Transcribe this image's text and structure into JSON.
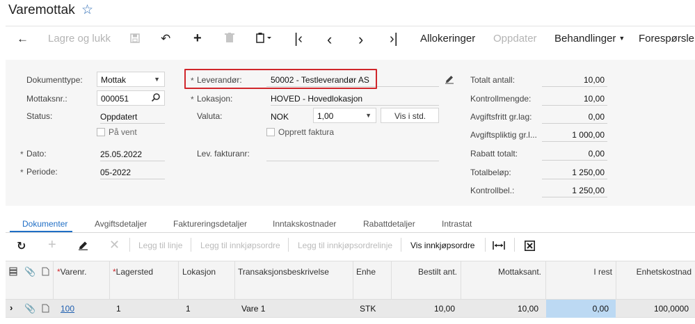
{
  "page": {
    "title": "Varemottak"
  },
  "toolbar": {
    "save_close": "Lagre og lukk",
    "allocations": "Allokeringer",
    "update": "Oppdater",
    "actions": "Behandlinger",
    "inquiries": "Forespørsler"
  },
  "form": {
    "doc_type": {
      "label": "Dokumenttype:",
      "value": "Mottak"
    },
    "receipt_no": {
      "label": "Mottaksnr.:",
      "value": "000051"
    },
    "status": {
      "label": "Status:",
      "value": "Oppdatert"
    },
    "on_hold": {
      "label": "På vent"
    },
    "date": {
      "label": "Dato:",
      "value": "25.05.2022"
    },
    "period": {
      "label": "Periode:",
      "value": "05-2022"
    },
    "supplier": {
      "label": "Leverandør:",
      "value": "50002 - Testleverandør AS"
    },
    "location": {
      "label": "Lokasjon:",
      "value": "HOVED - Hovedlokasjon"
    },
    "currency": {
      "label": "Valuta:",
      "code": "NOK",
      "rate": "1,00",
      "view_label": "Vis i std."
    },
    "create_invoice": {
      "label": "Opprett faktura"
    },
    "supplier_invoice": {
      "label": "Lev. fakturanr:",
      "value": ""
    }
  },
  "totals": [
    {
      "label": "Totalt antall:",
      "value": "10,00"
    },
    {
      "label": "Kontrollmengde:",
      "value": "10,00"
    },
    {
      "label": "Avgiftsfritt gr.lag:",
      "value": "0,00"
    },
    {
      "label": "Avgiftspliktig gr.l...",
      "value": "1 000,00"
    },
    {
      "label": "Rabatt totalt:",
      "value": "0,00"
    },
    {
      "label": "Totalbeløp:",
      "value": "1 250,00"
    },
    {
      "label": "Kontrollbel.:",
      "value": "1 250,00"
    }
  ],
  "tabs": [
    "Dokumenter",
    "Avgiftsdetaljer",
    "Faktureringsdetaljer",
    "Inntakskostnader",
    "Rabattdetaljer",
    "Intrastat"
  ],
  "grid_toolbar": {
    "add_line": "Legg til linje",
    "add_po": "Legg til innkjøpsordre",
    "add_po_line": "Legg til innkjøpsordrelinje",
    "view_po": "Vis innkjøpsordre"
  },
  "grid": {
    "columns": [
      "Varenr.",
      "Lagersted",
      "Lokasjon",
      "Transaksjonsbeskrivelse",
      "Enhe",
      "Bestilt ant.",
      "Mottaksant.",
      "I rest",
      "Enhetskostnad"
    ],
    "row": {
      "item": "100",
      "warehouse": "1",
      "location": "1",
      "description": "Vare 1",
      "unit": "STK",
      "ordered": "10,00",
      "received": "10,00",
      "remaining": "0,00",
      "unit_cost": "100,0000"
    }
  }
}
